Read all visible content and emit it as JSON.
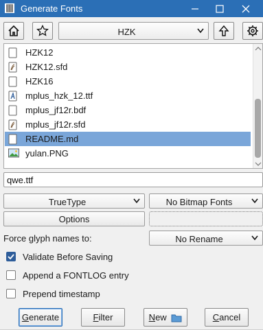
{
  "window": {
    "title": "Generate Fonts"
  },
  "toolbar": {
    "path_value": "HZK"
  },
  "files": [
    {
      "name": "HZK12",
      "icon": "blank-file-icon",
      "selected": false
    },
    {
      "name": "HZK12.sfd",
      "icon": "sfd-file-icon",
      "selected": false
    },
    {
      "name": "HZK16",
      "icon": "blank-file-icon",
      "selected": false
    },
    {
      "name": "mplus_hzk_12.ttf",
      "icon": "font-file-icon",
      "selected": false
    },
    {
      "name": "mplus_jf12r.bdf",
      "icon": "blank-file-icon",
      "selected": false
    },
    {
      "name": "mplus_jf12r.sfd",
      "icon": "sfd-file-icon",
      "selected": false
    },
    {
      "name": "README.md",
      "icon": "blank-file-icon",
      "selected": true
    },
    {
      "name": "yulan.PNG",
      "icon": "image-file-icon",
      "selected": false
    }
  ],
  "filename_input": {
    "value": "qwe.ttf"
  },
  "outline_format": {
    "value": "TrueType"
  },
  "bitmap_format": {
    "value": "No Bitmap Fonts"
  },
  "options_button": {
    "label": "Options"
  },
  "force_glyph": {
    "label": "Force glyph names to:",
    "value": "No Rename"
  },
  "checkboxes": {
    "validate": {
      "label": "Validate Before Saving",
      "checked": true
    },
    "fontlog": {
      "label": "Append a FONTLOG entry",
      "checked": false
    },
    "timestamp": {
      "label": "Prepend timestamp",
      "checked": false
    }
  },
  "buttons": {
    "generate": {
      "mnemonic": "G",
      "rest": "enerate"
    },
    "filter": {
      "mnemonic": "F",
      "rest": "ilter"
    },
    "new": {
      "mnemonic": "N",
      "rest": "ew"
    },
    "cancel": {
      "mnemonic": "C",
      "rest": "ancel"
    }
  },
  "colors": {
    "titlebar": "#2b6fb6",
    "selection": "#7aa6d9",
    "checkbox_on": "#2e5d9a"
  }
}
